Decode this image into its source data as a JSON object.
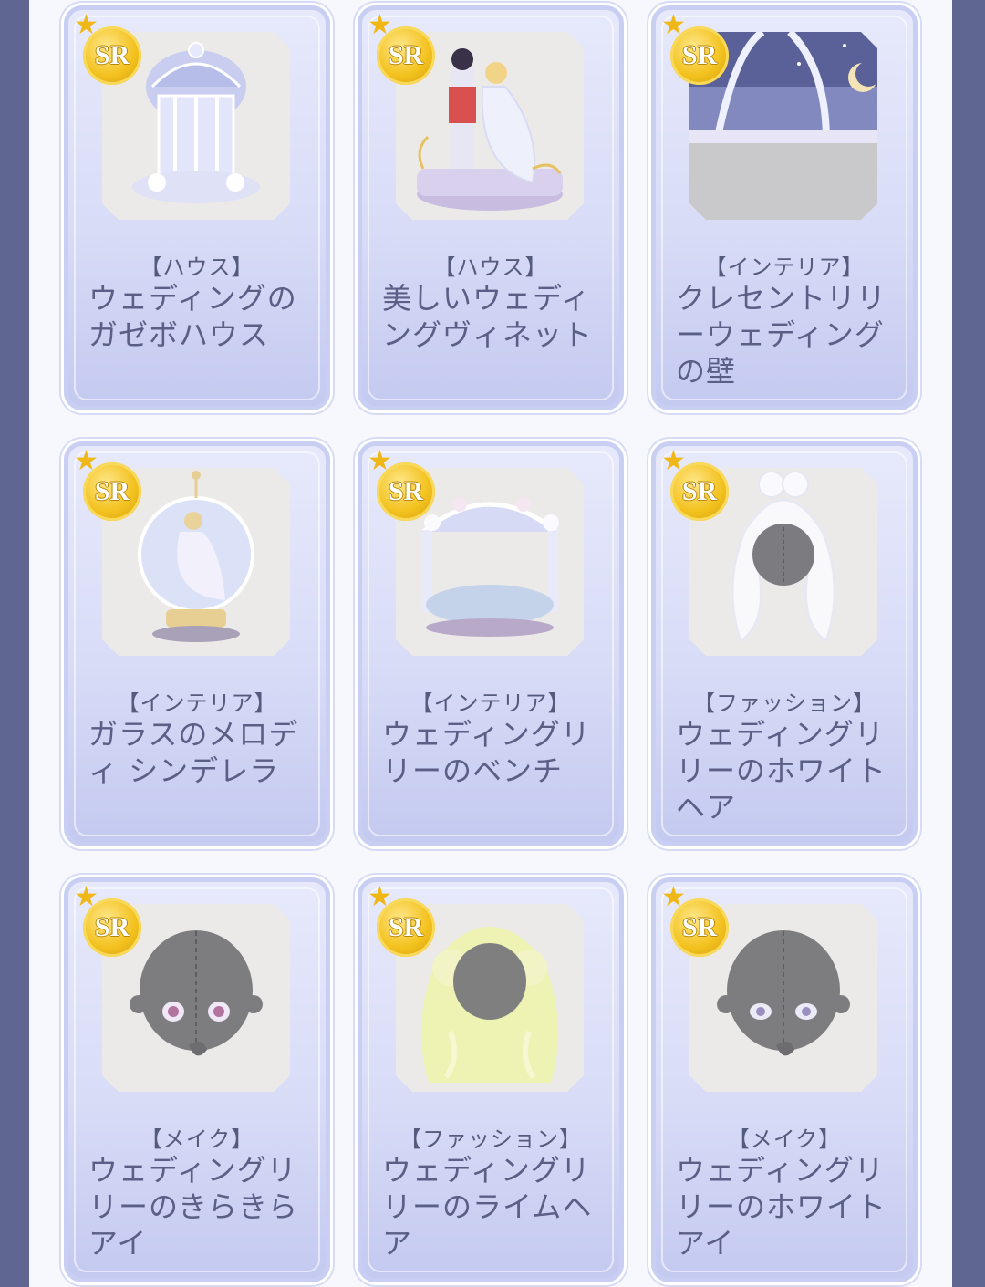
{
  "badge_label": "SR",
  "colors": {
    "frame": "#5f6691",
    "card_gradient_top": "#e7e9fb",
    "card_gradient_bottom": "#c4caf0",
    "badge_gold": "#f3c21f",
    "text": "#5a5f85"
  },
  "items": [
    {
      "category": "【ハウス】",
      "name": "ウェディングのガゼボハウス",
      "icon": "gazebo-house-icon"
    },
    {
      "category": "【ハウス】",
      "name": "美しいウェディングヴィネット",
      "icon": "wedding-couple-figurine-icon"
    },
    {
      "category": "【インテリア】",
      "name": "クレセントリリーウェディングの壁",
      "icon": "night-wall-icon"
    },
    {
      "category": "【インテリア】",
      "name": "ガラスのメロディ シンデレラ",
      "icon": "snow-globe-icon"
    },
    {
      "category": "【インテリア】",
      "name": "ウェディングリリーのベンチ",
      "icon": "flower-bench-icon"
    },
    {
      "category": "【ファッション】",
      "name": "ウェディングリリーのホワイトヘア",
      "icon": "white-hair-icon"
    },
    {
      "category": "【メイク】",
      "name": "ウェディングリリーのきらきらアイ",
      "icon": "sparkle-eye-makeup-icon"
    },
    {
      "category": "【ファッション】",
      "name": "ウェディングリリーのライムヘア",
      "icon": "lime-hair-icon"
    },
    {
      "category": "【メイク】",
      "name": "ウェディングリリーのホワイトアイ",
      "icon": "white-eye-makeup-icon"
    }
  ]
}
